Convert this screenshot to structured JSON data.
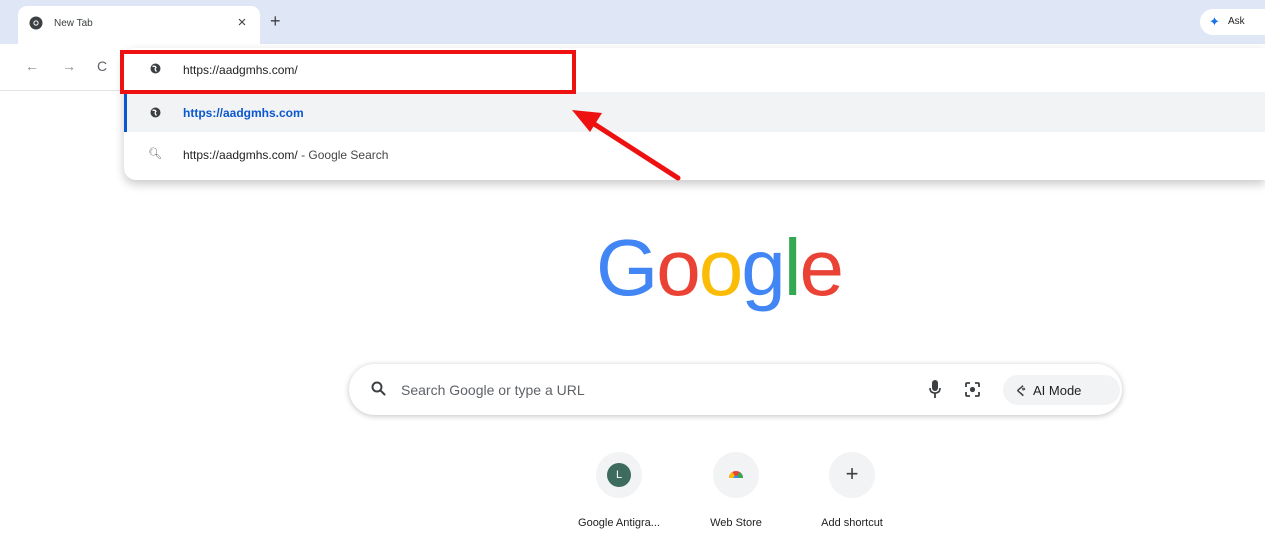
{
  "tab": {
    "title": "New Tab",
    "close_glyph": "×",
    "new_tab_glyph": "+"
  },
  "ask_button": {
    "label": "Ask"
  },
  "toolbar": {
    "back_glyph": "←",
    "forward_glyph": "→",
    "reload_glyph": "C"
  },
  "omnibox": {
    "value": "https://aadgmhs.com/",
    "suggestions": [
      {
        "icon": "globe-icon",
        "text": "https://aadgmhs.com"
      },
      {
        "icon": "search-icon",
        "text": "https://aadgmhs.com/",
        "suffix": " - Google Search"
      }
    ]
  },
  "logo": {
    "letters": [
      "G",
      "o",
      "o",
      "g",
      "l",
      "e"
    ]
  },
  "colors": {
    "g_blue": "#4285f4",
    "g_red": "#ea4335",
    "g_yellow": "#fbbc05",
    "g_green": "#34a853",
    "annotation_red": "#ee1111",
    "link_blue": "#0b57d0"
  },
  "searchbox": {
    "placeholder": "Search Google or type a URL",
    "ai_mode_label": "AI Mode"
  },
  "shortcuts": [
    {
      "label": "Google Antigra...",
      "initial": "L"
    },
    {
      "label": "Web Store"
    },
    {
      "label": "Add shortcut",
      "glyph": "+"
    }
  ]
}
